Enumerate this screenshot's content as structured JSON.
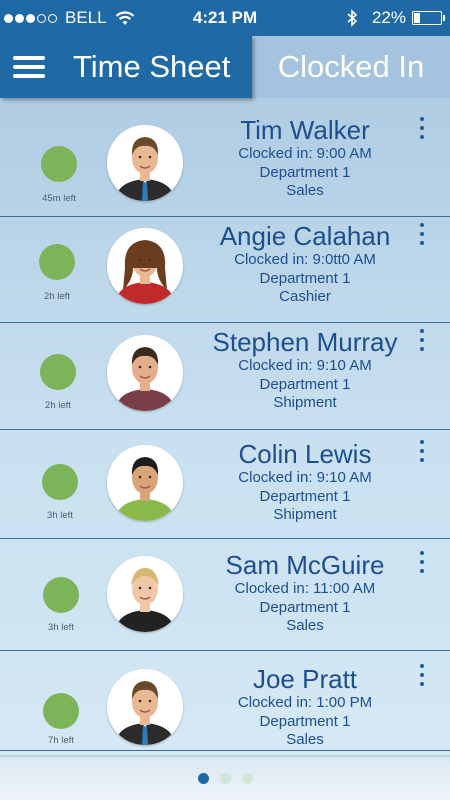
{
  "status_bar": {
    "carrier": "BELL",
    "time": "4:21 PM",
    "battery_pct": "22%",
    "battery_level": 0.22,
    "signal_bars_filled": 3,
    "signal_bars_total": 5
  },
  "nav": {
    "menu_icon": "hamburger-icon",
    "title": "Time Sheet",
    "active_tab": "Clocked In"
  },
  "employees": [
    {
      "name": "Tim Walker",
      "clocked_in": "Clocked in: 9:00 AM",
      "department": "Department 1",
      "role": "Sales",
      "time_left": "45m left",
      "status_color": "#7db45a"
    },
    {
      "name": "Angie Calahan",
      "clocked_in": "Clocked in: 9:0tt0 AM",
      "department": "Department 1",
      "role": "Cashier",
      "time_left": "2h left",
      "status_color": "#7db45a"
    },
    {
      "name": "Stephen Murray",
      "clocked_in": "Clocked in: 9:10 AM",
      "department": "Department 1",
      "role": "Shipment",
      "time_left": "2h left",
      "status_color": "#7db45a"
    },
    {
      "name": "Colin Lewis",
      "clocked_in": "Clocked in: 9:10 AM",
      "department": "Department 1",
      "role": "Shipment",
      "time_left": "3h left",
      "status_color": "#7db45a"
    },
    {
      "name": "Sam McGuire",
      "clocked_in": "Clocked in: 11:00 AM",
      "department": "Department 1",
      "role": "Sales",
      "time_left": "3h left",
      "status_color": "#7db45a"
    },
    {
      "name": "Joe Pratt",
      "clocked_in": "Clocked in: 1:00 PM",
      "department": "Department 1",
      "role": "Sales",
      "time_left": "7h left",
      "status_color": "#7db45a"
    }
  ],
  "pager": {
    "pages": 3,
    "current": 1
  },
  "colors": {
    "brand": "#1f6aa6",
    "accent_text": "#1d4f8f",
    "status_green": "#7db45a"
  }
}
